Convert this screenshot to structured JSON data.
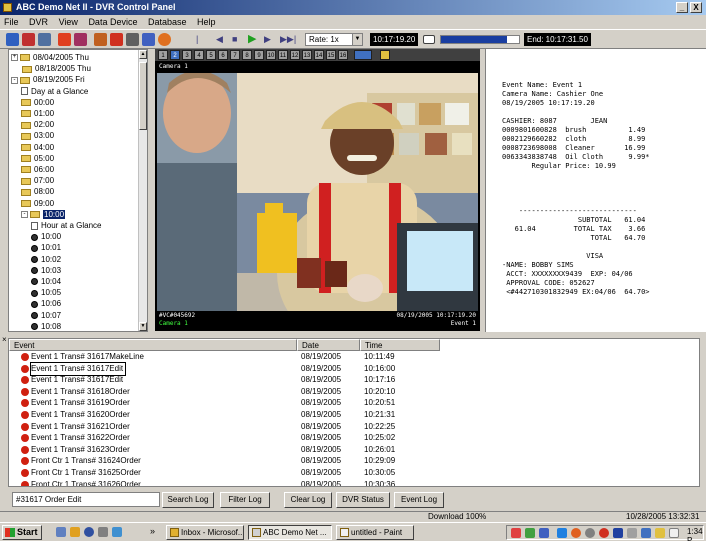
{
  "window": {
    "title": "ABC Demo Net II - DVR Control Panel",
    "controls": [
      "_",
      "X"
    ]
  },
  "menu": [
    "File",
    "DVR",
    "View",
    "Data Device",
    "Database",
    "Help"
  ],
  "toolbar": {
    "rate_label": "Rate: 1x",
    "current_time": "10:17:19.20",
    "progress_fraction": 0.85,
    "end_time": "End: 10:17:31.50"
  },
  "tree": {
    "items": [
      {
        "label": "08/04/2005 Thu",
        "type": "folder",
        "level": 0,
        "exp": "+"
      },
      {
        "label": "08/18/2005 Thu",
        "type": "folder",
        "level": 0,
        "exp": ""
      },
      {
        "label": "08/19/2005 Fri",
        "type": "folder",
        "level": 0,
        "exp": "-"
      },
      {
        "label": "Day at a Glance",
        "type": "doc",
        "level": 1,
        "exp": ""
      },
      {
        "label": "00:00",
        "type": "folder",
        "level": 1,
        "exp": ""
      },
      {
        "label": "01:00",
        "type": "folder",
        "level": 1,
        "exp": ""
      },
      {
        "label": "02:00",
        "type": "folder",
        "level": 1,
        "exp": ""
      },
      {
        "label": "03:00",
        "type": "folder",
        "level": 1,
        "exp": ""
      },
      {
        "label": "04:00",
        "type": "folder",
        "level": 1,
        "exp": ""
      },
      {
        "label": "05:00",
        "type": "folder",
        "level": 1,
        "exp": ""
      },
      {
        "label": "06:00",
        "type": "folder",
        "level": 1,
        "exp": ""
      },
      {
        "label": "07:00",
        "type": "folder",
        "level": 1,
        "exp": ""
      },
      {
        "label": "08:00",
        "type": "folder",
        "level": 1,
        "exp": ""
      },
      {
        "label": "09:00",
        "type": "folder",
        "level": 1,
        "exp": ""
      },
      {
        "label": "10:00",
        "type": "folder",
        "level": 1,
        "exp": "-",
        "selected": true
      },
      {
        "label": "Hour at a Glance",
        "type": "doc",
        "level": 2,
        "exp": ""
      },
      {
        "label": "10:00",
        "type": "clock",
        "level": 2,
        "exp": ""
      },
      {
        "label": "10:01",
        "type": "clock",
        "level": 2,
        "exp": ""
      },
      {
        "label": "10:02",
        "type": "clock",
        "level": 2,
        "exp": ""
      },
      {
        "label": "10:03",
        "type": "clock",
        "level": 2,
        "exp": ""
      },
      {
        "label": "10:04",
        "type": "clock",
        "level": 2,
        "exp": ""
      },
      {
        "label": "10:05",
        "type": "clock",
        "level": 2,
        "exp": ""
      },
      {
        "label": "10:06",
        "type": "clock",
        "level": 2,
        "exp": ""
      },
      {
        "label": "10:07",
        "type": "clock",
        "level": 2,
        "exp": ""
      },
      {
        "label": "10:08",
        "type": "clock",
        "level": 2,
        "exp": ""
      }
    ]
  },
  "camera": {
    "tabs": [
      "1",
      "2",
      "3",
      "4",
      "5",
      "6",
      "7",
      "8",
      "9",
      "10",
      "11",
      "12",
      "13",
      "14",
      "15",
      "16"
    ],
    "active_tab": "2",
    "label": "Camera 1",
    "overlay_left": "#VC#045692",
    "overlay_left2": "Camera 1",
    "overlay_right": "08/19/2005 10:17:19.20",
    "overlay_right2": "Event 1"
  },
  "receipt": {
    "lines": [
      "Event Name: Event 1",
      "Camera Name: Cashier One",
      "08/19/2005 10:17:19.20",
      "",
      "CASHIER: 8087        JEAN",
      "0009801600828  brush          1.49",
      "0002129660282  cloth          8.99",
      "0008723698008  Cleaner       16.99",
      "0063343838748  Oil Cloth      9.99*",
      "       Regular Price: 10.99",
      "",
      "",
      "",
      "",
      "    ----------------------------",
      "                  SUBTOTAL   61.04",
      "   61.04         TOTAL TAX    3.66",
      "                     TOTAL   64.70",
      "",
      "                    VISA",
      "-NAME: BOBBY SIMS",
      " ACCT: XXXXXXXX9439  EXP: 04/06",
      " APPROVAL CODE: 052627",
      " <#442710301832949 EX:04/06  64.70>"
    ]
  },
  "events": {
    "columns": [
      "Event",
      "Date",
      "Time"
    ],
    "rows": [
      {
        "event": "Event 1 Trans# 31617MakeLine",
        "date": "08/19/2005",
        "time": "10:11:49"
      },
      {
        "event": "Event 1 Trans# 31617Edit",
        "date": "08/19/2005",
        "time": "10:16:00",
        "focus": true
      },
      {
        "event": "Event 1 Trans# 31617Edit",
        "date": "08/19/2005",
        "time": "10:17:16"
      },
      {
        "event": "Event 1 Trans# 31618Order",
        "date": "08/19/2005",
        "time": "10:20:10"
      },
      {
        "event": "Event 1 Trans# 31619Order",
        "date": "08/19/2005",
        "time": "10:20:51"
      },
      {
        "event": "Event 1 Trans# 31620Order",
        "date": "08/19/2005",
        "time": "10:21:31"
      },
      {
        "event": "Event 1 Trans# 31621Order",
        "date": "08/19/2005",
        "time": "10:22:25"
      },
      {
        "event": "Event 1 Trans# 31622Order",
        "date": "08/19/2005",
        "time": "10:25:02"
      },
      {
        "event": "Event 1 Trans# 31623Order",
        "date": "08/19/2005",
        "time": "10:26:01"
      },
      {
        "event": "Front Ctr 1 Trans# 31624Order",
        "date": "08/19/2005",
        "time": "10:29:09"
      },
      {
        "event": "Front Ctr 1 Trans# 31625Order",
        "date": "08/19/2005",
        "time": "10:30:05"
      },
      {
        "event": "Front Ctr 1 Trans# 31626Order",
        "date": "08/19/2005",
        "time": "10:30:36"
      }
    ]
  },
  "search": {
    "value": "#31617 Order Edit",
    "buttons": [
      "Search Log",
      "Filter Log",
      "Clear Log",
      "DVR Status",
      "Event Log"
    ]
  },
  "status": {
    "download": "Download 100%",
    "datetime": "10/28/2005 13:32:31"
  },
  "taskbar": {
    "start": "Start",
    "chevron": "»",
    "tasks": [
      "Inbox - Microsof...",
      "ABC Demo Net ...",
      "untitled - Paint"
    ],
    "clock": "1:34 P"
  }
}
